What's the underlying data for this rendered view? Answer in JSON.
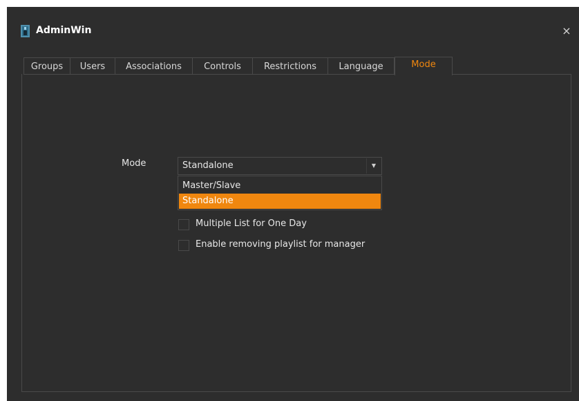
{
  "window": {
    "title": "AdminWin",
    "close_glyph": "×"
  },
  "tabs": [
    {
      "label": "Groups"
    },
    {
      "label": "Users"
    },
    {
      "label": "Associations"
    },
    {
      "label": "Controls"
    },
    {
      "label": "Restrictions"
    },
    {
      "label": "Language"
    },
    {
      "label": "Mode",
      "active": true
    }
  ],
  "mode": {
    "label": "Mode",
    "selected": "Standalone",
    "options": [
      "Master/Slave",
      "Standalone"
    ],
    "dropdown_open": true
  },
  "options": [
    {
      "label": "Multiple List for One Day",
      "checked": false
    },
    {
      "label": "Enable removing playlist for manager",
      "checked": false
    }
  ],
  "colors": {
    "background": "#2d2d2d",
    "border": "#4a4a4a",
    "accent": "#f0870f",
    "text": "#e8e8e8"
  },
  "icons": {
    "app": "admin-app-icon",
    "close": "close-icon",
    "dropdown": "chevron-down-icon"
  }
}
